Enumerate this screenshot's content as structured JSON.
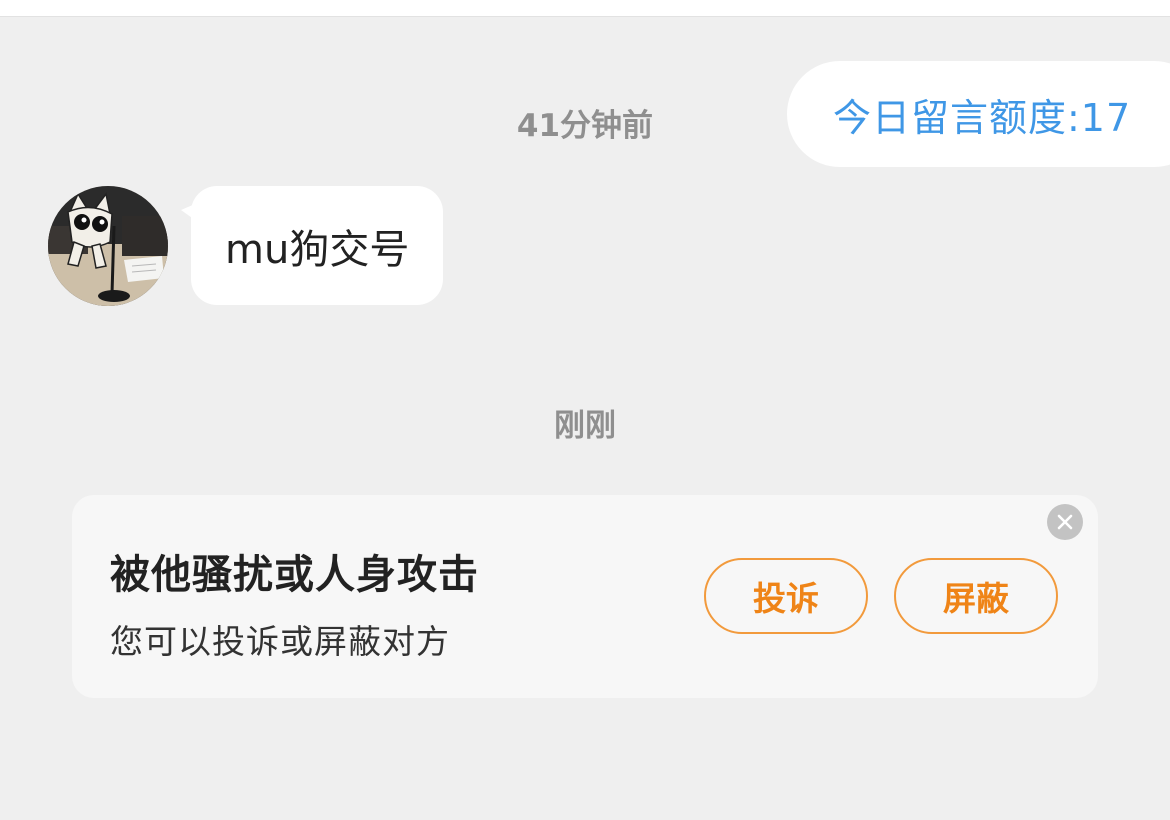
{
  "header": {
    "quota_label": "今日留言额度:17"
  },
  "conversation": {
    "timestamp_1": "41分钟前",
    "message_1": {
      "text": "mu狗交号",
      "avatar_icon": "cat-avatar-icon"
    },
    "timestamp_2": "刚刚"
  },
  "harassment_card": {
    "title": "被他骚扰或人身攻击",
    "subtitle": "您可以投诉或屏蔽对方",
    "report_label": "投诉",
    "block_label": "屏蔽",
    "close_icon": "close-icon"
  },
  "colors": {
    "accent_blue": "#3f97e6",
    "accent_orange": "#ef8417",
    "background": "#efefef"
  }
}
